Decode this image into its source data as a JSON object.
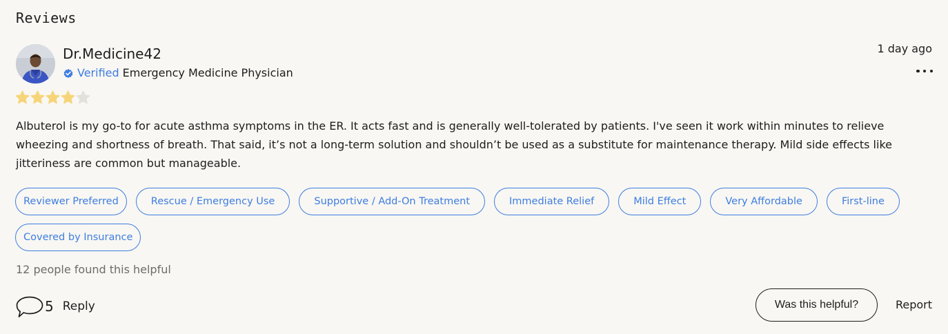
{
  "section": {
    "title": "Reviews"
  },
  "review": {
    "author": "Dr.Medicine42",
    "verified_label": "Verified",
    "role": "Emergency Medicine Physician",
    "timestamp": "1 day ago",
    "rating": 4,
    "rating_max": 5,
    "body": "Albuterol is my go-to for acute asthma symptoms in the ER. It acts fast and is generally well-tolerated by patients. I've seen it work within minutes to relieve wheezing and shortness of breath. That said, it’s not a long-term solution and shouldn’t be used as a substitute for maintenance therapy. Mild side effects like jitteriness are common but manageable.",
    "tags": [
      "Reviewer Preferred",
      "Rescue / Emergency Use",
      "Supportive / Add-On Treatment",
      "Immediate Relief",
      "Mild Effect",
      "Very Affordable",
      "First-line",
      "Covered by Insurance"
    ],
    "helpful_count_text": "12 people found this helpful",
    "reply_count": "5",
    "reply_label": "Reply",
    "helpful_button_label": "Was this helpful?",
    "report_label": "Report"
  },
  "icons": {
    "verified": "verified-badge-icon",
    "more": "more-options-icon",
    "star": "star-icon",
    "comment": "comment-bubble-icon"
  },
  "colors": {
    "background": "#f8f7f3",
    "accent": "#3f7de0",
    "star_filled": "#f6d57a",
    "star_empty": "#e3e1dc",
    "muted_text": "#6c6c6c"
  }
}
